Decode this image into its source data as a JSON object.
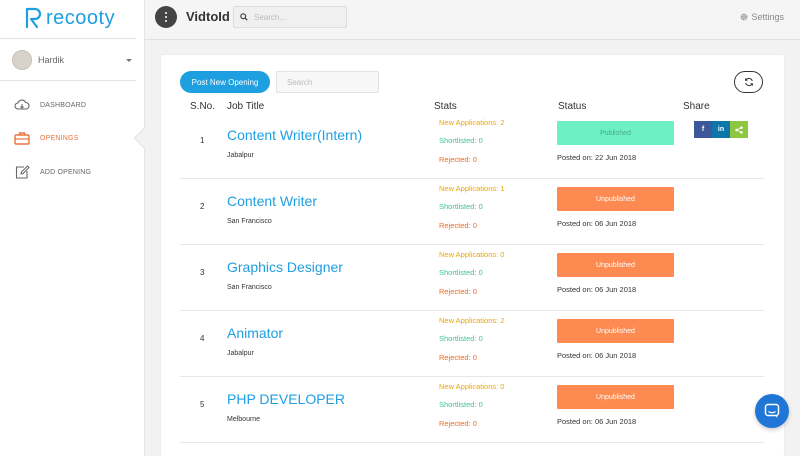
{
  "brand": {
    "name": "recooty",
    "color": "#1e9fe0"
  },
  "sidebar": {
    "user": {
      "name": "Hardik"
    },
    "items": [
      {
        "label": "DASHBOARD",
        "icon": "cloud-icon",
        "active": false
      },
      {
        "label": "OPENINGS",
        "icon": "briefcase-icon",
        "active": true
      },
      {
        "label": "ADD OPENING",
        "icon": "edit-icon",
        "active": false
      }
    ]
  },
  "topbar": {
    "title": "VidtoId",
    "search_placeholder": "Search...",
    "settings_label": "Settings"
  },
  "toolbar": {
    "post_button": "Post New Opening",
    "search_placeholder": "Search"
  },
  "table": {
    "headers": {
      "sno": "S.No.",
      "job_title": "Job Title",
      "stats": "Stats",
      "status": "Status",
      "share": "Share"
    },
    "rows": [
      {
        "sno": "1",
        "title": "Content Writer(Intern)",
        "location": "Jabalpur",
        "new_apps": "New Applications: 2",
        "shortlisted": "Shortlisted: 0",
        "rejected": "Rejected: 0",
        "status": "Published",
        "posted": "Posted on: 22 Jun 2018"
      },
      {
        "sno": "2",
        "title": "Content Writer",
        "location": "San Francisco",
        "new_apps": "New Applications: 1",
        "shortlisted": "Shortlisted: 0",
        "rejected": "Rejected: 0",
        "status": "Unpublished",
        "posted": "Posted on: 06 Jun 2018"
      },
      {
        "sno": "3",
        "title": "Graphics Designer",
        "location": "San Francisco",
        "new_apps": "New Applications: 0",
        "shortlisted": "Shortlisted: 0",
        "rejected": "Rejected: 0",
        "status": "Unpublished",
        "posted": "Posted on: 06 Jun 2018"
      },
      {
        "sno": "4",
        "title": "Animator",
        "location": "Jabalpur",
        "new_apps": "New Applications: 2",
        "shortlisted": "Shortlisted: 0",
        "rejected": "Rejected: 0",
        "status": "Unpublished",
        "posted": "Posted on: 06 Jun 2018"
      },
      {
        "sno": "5",
        "title": "PHP DEVELOPER",
        "location": "Melbourne",
        "new_apps": "New Applications: 0",
        "shortlisted": "Shortlisted: 0",
        "rejected": "Rejected: 0",
        "status": "Unpublished",
        "posted": "Posted on: 06 Jun 2018"
      }
    ],
    "share_buttons": [
      {
        "label": "f",
        "icon": "facebook-icon",
        "color": "#3b5998"
      },
      {
        "label": "in",
        "icon": "linkedin-icon",
        "color": "#0e76a8"
      },
      {
        "label": "<",
        "icon": "share-icon",
        "color": "#8dc63f"
      }
    ]
  },
  "colors": {
    "published": "#6ef0c5",
    "unpublished": "#fd8a51",
    "new_apps": "#f0a500",
    "shortlisted": "#3fc29c",
    "rejected": "#f06a20",
    "chat": "#1f76d6"
  }
}
